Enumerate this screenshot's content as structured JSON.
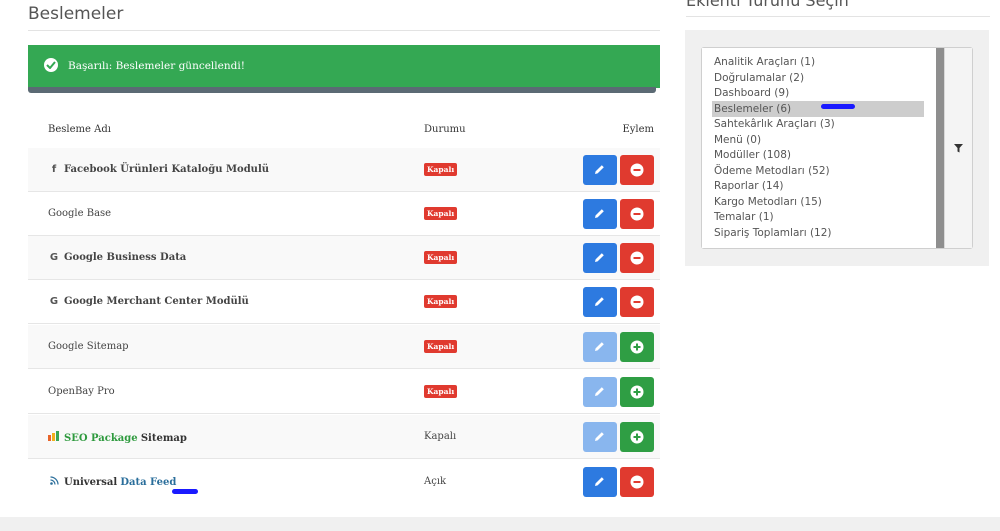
{
  "page": {
    "title": "Beslemeler"
  },
  "alert": {
    "message": "Başarılı: Beslemeler güncellendi!"
  },
  "table": {
    "headers": {
      "name": "Besleme Adı",
      "status": "Durumu",
      "action": "Eylem"
    },
    "rows": [
      {
        "icon": "facebook-icon",
        "icon_glyph": "f",
        "name": "Facebook Ürünleri Kataloğu Modulü",
        "status": "Kapalı"
      },
      {
        "name": "Google Base",
        "status": "Kapalı"
      },
      {
        "icon": "google-icon",
        "icon_glyph": "G",
        "name": "Google Business Data",
        "status": "Kapalı"
      },
      {
        "icon": "google-icon",
        "icon_glyph": "G",
        "name": "Google Merchant Center Modülü",
        "status": "Kapalı"
      },
      {
        "name": "Google Sitemap",
        "status": "Kapalı"
      },
      {
        "name": "OpenBay Pro",
        "status": "Kapalı"
      },
      {
        "name_part1": "SEO Package",
        "name_part2": "Sitemap",
        "status": "Kapalı"
      },
      {
        "name_part1": "Universal",
        "name_part2": "Data Feed",
        "status": "Açık"
      }
    ]
  },
  "filter": {
    "title": "Eklenti Türünü Seçin",
    "selected": "Beslemeler (6)",
    "options": [
      "Analitik Araçları (1)",
      "Doğrulamalar (2)",
      "Dashboard (9)",
      "Beslemeler (6)",
      "Sahtekârlık Araçları (3)",
      "Menü (0)",
      "Modüller (108)",
      "Ödeme Metodları (52)",
      "Raporlar (14)",
      "Kargo Metodları (15)",
      "Temalar (1)",
      "Sipariş Toplamları (12)"
    ]
  },
  "colors": {
    "success": "#34a853",
    "edit": "#2d7ae0",
    "remove": "#e03a2f",
    "add": "#2f9e44",
    "status_off": "#e03a2f",
    "annotation": "#1a1aff"
  }
}
